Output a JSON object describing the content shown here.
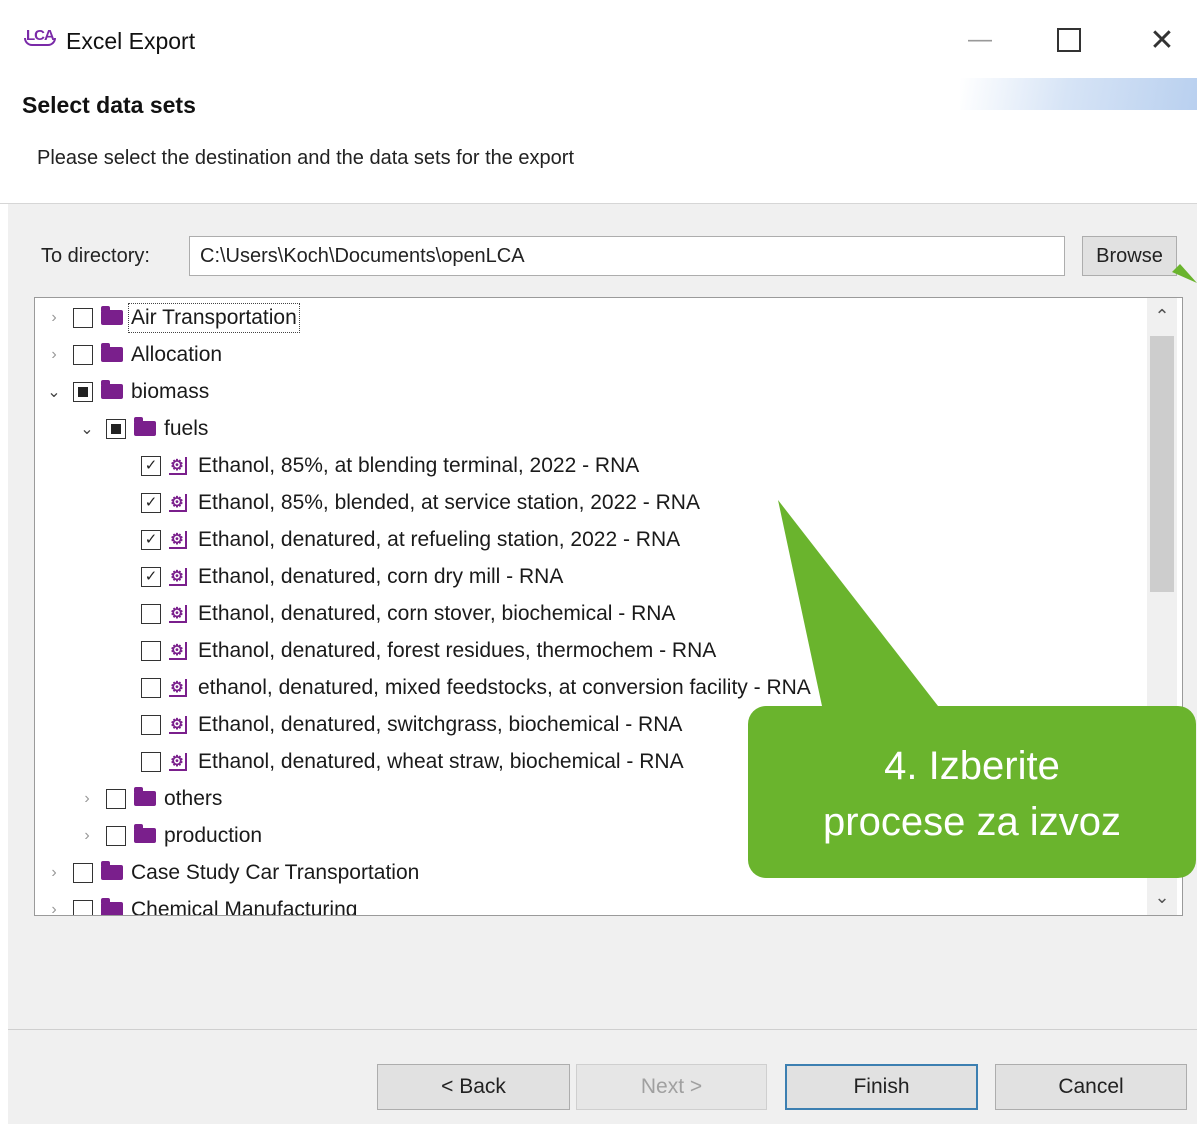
{
  "window": {
    "app_icon": "LCA",
    "title": "Excel Export",
    "minimize_glyph": "—",
    "maximize_glyph": "",
    "close_glyph": "✕"
  },
  "header": {
    "heading": "Select data sets",
    "description": "Please select the destination and the data sets for the export"
  },
  "directory": {
    "label": "To directory:",
    "value": "C:\\Users\\Koch\\Documents\\openLCA",
    "browse_label": "Browse"
  },
  "tree": {
    "rows": [
      {
        "label": "Air Transportation",
        "type": "folder",
        "level": 0,
        "expander": "collapsed",
        "check": "unchecked",
        "focused": true
      },
      {
        "label": "Allocation",
        "type": "folder",
        "level": 0,
        "expander": "collapsed",
        "check": "unchecked"
      },
      {
        "label": "biomass",
        "type": "folder",
        "level": 0,
        "expander": "expanded",
        "check": "partial"
      },
      {
        "label": "fuels",
        "type": "folder",
        "level": 1,
        "expander": "expanded",
        "check": "partial"
      },
      {
        "label": "Ethanol, 85%, at blending terminal, 2022 - RNA",
        "type": "process",
        "level": 2,
        "check": "checked"
      },
      {
        "label": "Ethanol, 85%, blended, at service station, 2022 - RNA",
        "type": "process",
        "level": 2,
        "check": "checked"
      },
      {
        "label": "Ethanol, denatured, at refueling station, 2022 - RNA",
        "type": "process",
        "level": 2,
        "check": "checked"
      },
      {
        "label": "Ethanol, denatured, corn dry mill - RNA",
        "type": "process",
        "level": 2,
        "check": "checked"
      },
      {
        "label": "Ethanol, denatured, corn stover, biochemical - RNA",
        "type": "process",
        "level": 2,
        "check": "unchecked"
      },
      {
        "label": "Ethanol, denatured, forest residues, thermochem - RNA",
        "type": "process",
        "level": 2,
        "check": "unchecked"
      },
      {
        "label": "ethanol, denatured, mixed feedstocks, at conversion facility - RNA",
        "type": "process",
        "level": 2,
        "check": "unchecked"
      },
      {
        "label": "Ethanol, denatured, switchgrass, biochemical - RNA",
        "type": "process",
        "level": 2,
        "check": "unchecked"
      },
      {
        "label": "Ethanol, denatured, wheat straw, biochemical - RNA",
        "type": "process",
        "level": 2,
        "check": "unchecked"
      },
      {
        "label": "others",
        "type": "folder",
        "level": 1,
        "expander": "collapsed",
        "check": "unchecked"
      },
      {
        "label": "production",
        "type": "folder",
        "level": 1,
        "expander": "collapsed",
        "check": "unchecked"
      },
      {
        "label": "Case Study Car Transportation",
        "type": "folder",
        "level": 0,
        "expander": "collapsed",
        "check": "unchecked"
      },
      {
        "label": "Chemical Manufacturing",
        "type": "folder",
        "level": 0,
        "expander": "collapsed",
        "check": "unchecked"
      }
    ]
  },
  "buttons": {
    "back": "< Back",
    "next": "Next >",
    "finish": "Finish",
    "cancel": "Cancel"
  },
  "callout": {
    "line1": "4. Izberite",
    "line2": "procese za izvoz",
    "color": "#6ab42d"
  },
  "colors": {
    "folder": "#7a1f8c",
    "focus_border": "#3c7fb1"
  }
}
